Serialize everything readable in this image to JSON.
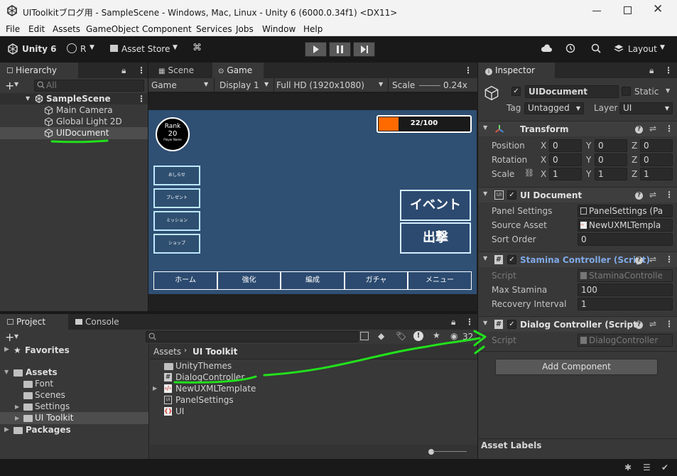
{
  "window": {
    "title": "UIToolkitブログ用 - SampleScene - Windows, Mac, Linux - Unity 6 (6000.0.34f1) <DX11>"
  },
  "menu": [
    "File",
    "Edit",
    "Assets",
    "GameObject",
    "Component",
    "Services",
    "Jobs",
    "Window",
    "Help"
  ],
  "toolbar": {
    "version": "Unity 6",
    "account": "R",
    "asset_store": "Asset Store",
    "layout": "Layout"
  },
  "hierarchy": {
    "tab": "Hierarchy",
    "search_placeholder": "All",
    "scene": "SampleScene",
    "items": [
      "Main Camera",
      "Global Light 2D",
      "UIDocument"
    ],
    "selected": "UIDocument"
  },
  "game_view": {
    "tabs": [
      "Scene",
      "Game"
    ],
    "active_tab": "Game",
    "mode": "Game",
    "display": "Display 1",
    "resolution": "Full HD (1920x1080)",
    "scale_label": "Scale",
    "scale_value": "0.24x"
  },
  "game_ui": {
    "rank_label": "Rank",
    "rank_value": "20",
    "player_name": "Player Name",
    "stamina_text": "22/100",
    "stamina_fraction": 0.22,
    "side_buttons": [
      "おしらせ",
      "プレゼント",
      "ミッション",
      "ショップ"
    ],
    "big_buttons": [
      "イベント",
      "出撃"
    ],
    "nav_buttons": [
      "ホーム",
      "強化",
      "編成",
      "ガチャ",
      "メニュー"
    ],
    "bg_color": "#2f4f73"
  },
  "project": {
    "tabs": [
      "Project",
      "Console"
    ],
    "favorites": "Favorites",
    "assets": "Assets",
    "asset_folders": [
      "Font",
      "Scenes",
      "Settings",
      "UI Toolkit"
    ],
    "packages": "Packages",
    "breadcrumb": [
      "Assets",
      "UI Toolkit"
    ],
    "files": [
      "UnityThemes",
      "DialogController",
      "NewUXMLTemplate",
      "PanelSettings",
      "UI"
    ],
    "count": "32"
  },
  "inspector": {
    "tab": "Inspector",
    "object_name": "UIDocument",
    "static_label": "Static",
    "tag_label": "Tag",
    "tag_value": "Untagged",
    "layer_label": "Layer",
    "layer_value": "UI",
    "transform": {
      "title": "Transform",
      "position_label": "Position",
      "rotation_label": "Rotation",
      "scale_label": "Scale",
      "position": [
        "0",
        "0",
        "0"
      ],
      "rotation": [
        "0",
        "0",
        "0"
      ],
      "scale": [
        "1",
        "1",
        "1"
      ]
    },
    "ui_document": {
      "title": "UI Document",
      "panel_settings_label": "Panel Settings",
      "panel_settings_value": "PanelSettings (Pa",
      "source_asset_label": "Source Asset",
      "source_asset_value": "NewUXMLTempla",
      "sort_order_label": "Sort Order",
      "sort_order_value": "0"
    },
    "stamina_controller": {
      "title": "Stamina Controller (Script)",
      "script_label": "Script",
      "script_value": "StaminaControlle",
      "max_stamina_label": "Max Stamina",
      "max_stamina_value": "100",
      "recovery_label": "Recovery Interval",
      "recovery_value": "1"
    },
    "dialog_controller": {
      "title": "Dialog Controller (Script)",
      "script_label": "Script",
      "script_value": "DialogController"
    },
    "add_component": "Add Component",
    "asset_labels": "Asset Labels"
  },
  "colors": {
    "annotation_green": "#22e11c",
    "accent_blue": "#3a72b0",
    "stamina_orange": "#ff6a00"
  }
}
